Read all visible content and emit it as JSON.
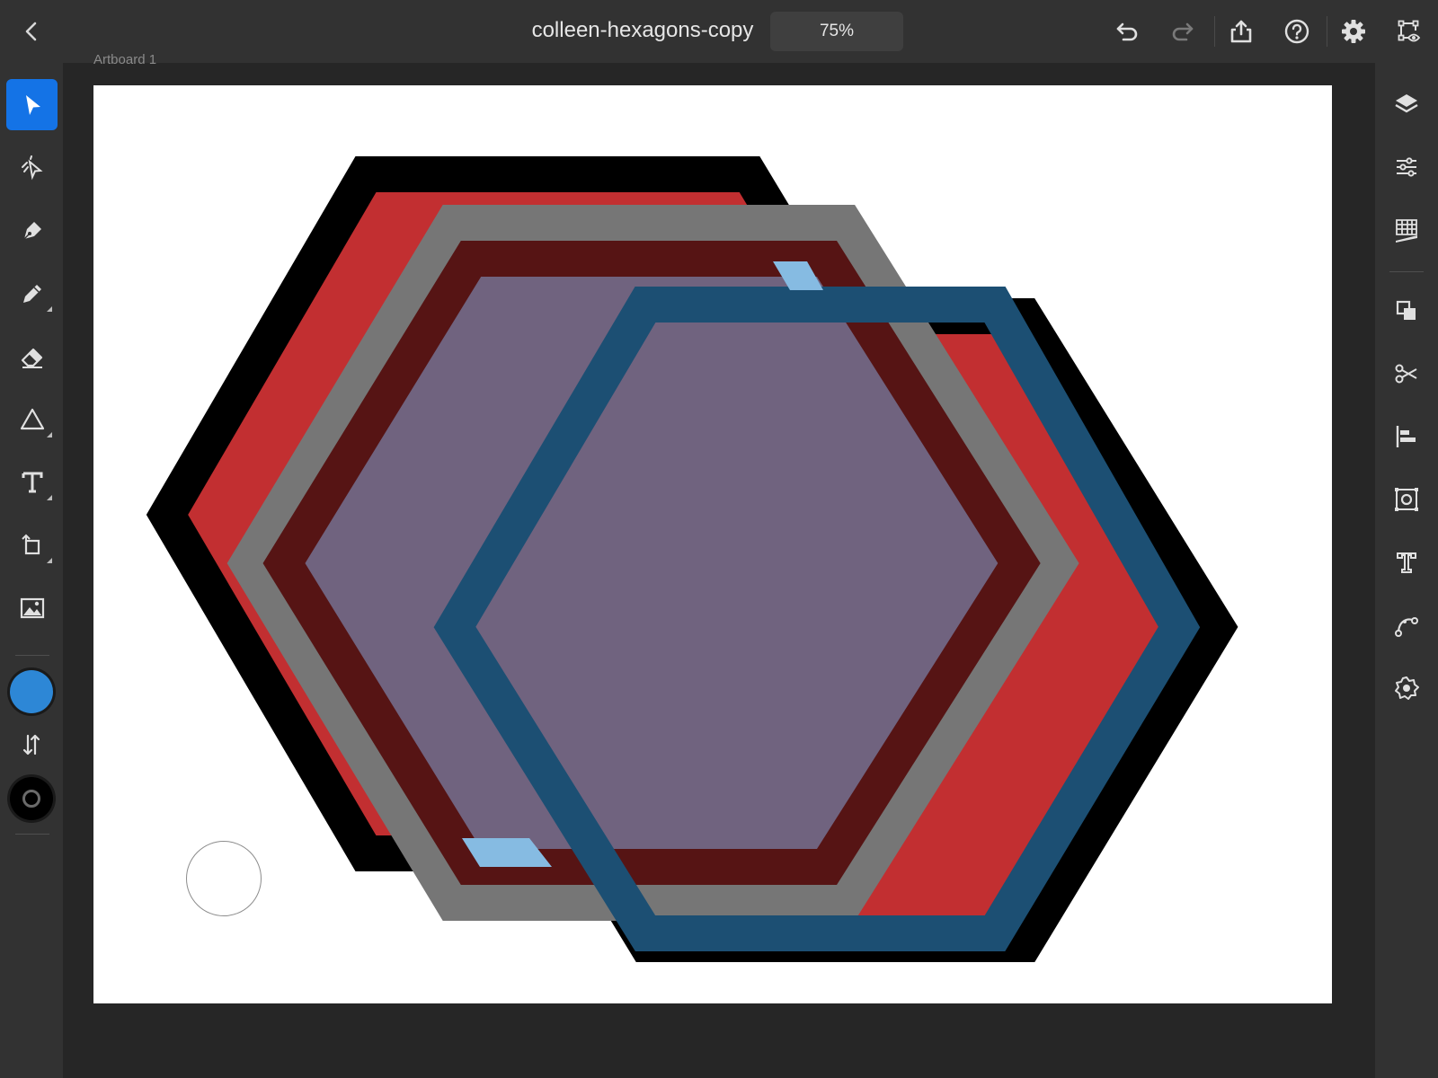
{
  "header": {
    "document_title": "colleen-hexagons-copy",
    "zoom_level": "75%"
  },
  "canvas": {
    "artboard_label": "Artboard 1"
  },
  "colors": {
    "accent": "#1473e6",
    "fill_swatch": "#2d87d6",
    "stroke_swatch": "#000000",
    "red_hexagon": "#c22f31",
    "violet_hexagon": "#70637f",
    "blue_stroke": "#1c4f73",
    "light_blue": "#86bbe2",
    "dark_red_stroke": "#561414"
  },
  "tools": [
    "select-tool",
    "direct-select-tool",
    "pen-tool",
    "pencil-tool",
    "eraser-tool",
    "shape-tool",
    "type-tool",
    "transform-tool",
    "image-tool"
  ],
  "panels": [
    "layers",
    "properties",
    "grid",
    "combine-shapes",
    "cut",
    "align",
    "repeat-grid",
    "type-properties",
    "path-edit",
    "plugins"
  ]
}
